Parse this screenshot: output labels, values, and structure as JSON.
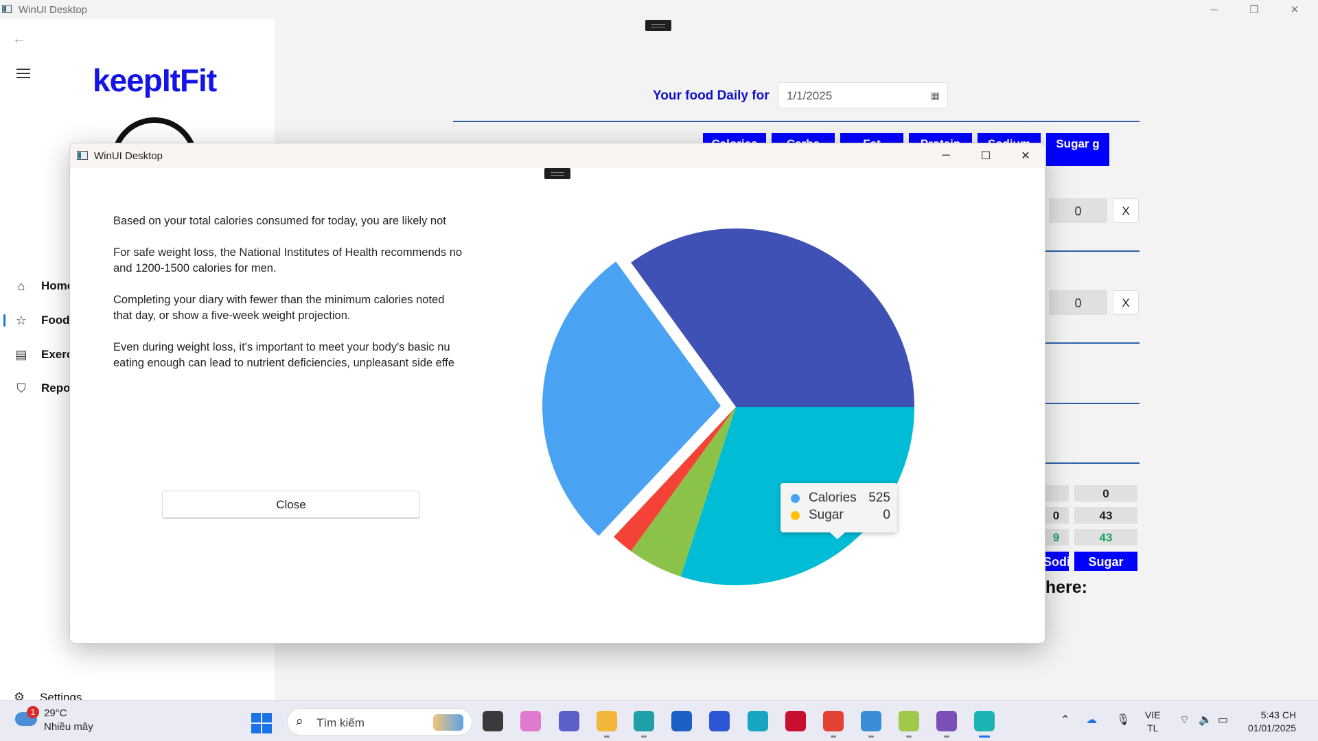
{
  "main_window": {
    "title": "WinUI Desktop",
    "logo": "keepItFit",
    "nav_items": [
      {
        "label": "Home",
        "icon": "home-icon"
      },
      {
        "label": "Food",
        "icon": "star-icon",
        "selected": true
      },
      {
        "label": "Exercise",
        "icon": "exercise-icon"
      },
      {
        "label": "Report",
        "icon": "shield-icon"
      }
    ],
    "settings_label": "Settings",
    "food_header_label": "Your food Daily for",
    "date_value": "1/1/2025",
    "column_headers": [
      "Calories",
      "Carbs",
      "Fat",
      "Protein",
      "Sodium",
      "Sugar g"
    ],
    "row_values": [
      "0",
      "0"
    ],
    "remove_label": "X",
    "summary_rows": [
      [
        "",
        "0"
      ],
      [
        "0",
        "43"
      ],
      [
        "9",
        "43"
      ]
    ],
    "summary_footer": [
      "Sodium",
      "Sugar"
    ],
    "bottom_text": "k here:"
  },
  "dialog": {
    "title": "WinUI Desktop",
    "message": [
      "Based on your total calories consumed for today, you are likely not",
      "For safe weight loss, the National Institutes of Health recommends no",
      "and 1200-1500 calories for men.",
      "Completing your diary with fewer than the minimum calories noted",
      "that day, or show a five-week weight projection.",
      "Even during weight loss, it's important to meet your body's basic nu",
      "eating enough can lead to nutrient deficiencies, unpleasant side effe"
    ],
    "close_label": "Close",
    "tooltip": [
      {
        "name": "Calories",
        "value": "525",
        "color": "#42a5f5"
      },
      {
        "name": "Sugar",
        "value": "0",
        "color": "#ffc107"
      }
    ]
  },
  "chart_data": {
    "type": "pie",
    "title": "",
    "slices": [
      {
        "value": 35,
        "color": "#3f51b5"
      },
      {
        "value": 28,
        "color": "#4aa3f2",
        "exploded": true
      },
      {
        "value": 2,
        "color": "#f44336"
      },
      {
        "value": 5,
        "color": "#8bc34a"
      },
      {
        "value": 30,
        "color": "#00bcd4"
      }
    ]
  },
  "taskbar": {
    "weather_temp": "29°C",
    "weather_desc": "Nhiều mây",
    "weather_badge": "1",
    "search_placeholder": "Tìm kiếm",
    "apps": [
      {
        "icon": "task-view-icon",
        "color": "#3a3a3a"
      },
      {
        "icon": "copilot-icon",
        "color": "#e07ad0"
      },
      {
        "icon": "teams-icon",
        "color": "#5b5fc7"
      },
      {
        "icon": "file-explorer-icon",
        "color": "#f2b73a"
      },
      {
        "icon": "edge-icon",
        "color": "#1fa0a8"
      },
      {
        "icon": "store-icon",
        "color": "#1c5fc7"
      },
      {
        "icon": "app-icon",
        "color": "#2b57d6"
      },
      {
        "icon": "app-icon",
        "color": "#17a7c2"
      },
      {
        "icon": "mcafee-icon",
        "color": "#c8102e"
      },
      {
        "icon": "chrome-icon",
        "color": "#e34133"
      },
      {
        "icon": "app-icon",
        "color": "#3a8ed8"
      },
      {
        "icon": "app-icon",
        "color": "#9ec94a"
      },
      {
        "icon": "visual-studio-icon",
        "color": "#7b4fb8"
      },
      {
        "icon": "winui-app-icon",
        "color": "#1bb3b3"
      }
    ],
    "lang_line1": "VIE",
    "lang_line2": "TL",
    "time": "5:43 CH",
    "date": "01/01/2025"
  }
}
